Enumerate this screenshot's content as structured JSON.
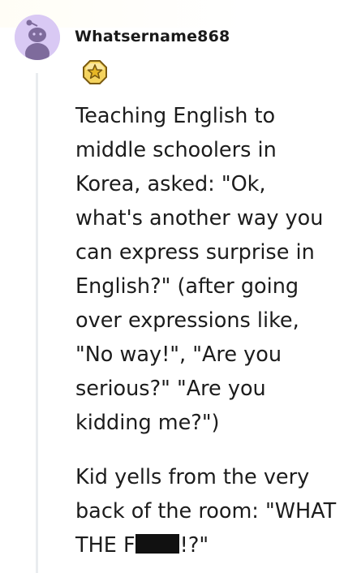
{
  "comment": {
    "author": "Whatsername868",
    "award_icon": "gold-award-star-icon",
    "avatar_icon": "snoo-avatar-icon",
    "paragraph_1": "Teaching English to\nmiddle schoolers in\nKorea, asked: \"Ok,\nwhat's another way you\ncan express surprise in\nEnglish?\" (after going\nover expressions like,\n\"No way!\", \"Are you\nserious?\" \"Are you\nkidding me?\")",
    "paragraph_2_start": "Kid yells from the very\nback of the room: \"WHAT\nTHE F",
    "paragraph_2_end": "!?\""
  },
  "colors": {
    "avatar_bg": "#d9c9f4",
    "avatar_figure": "#7e6b9c",
    "award_gold": "#e6b625",
    "thread_line": "#e9ecef",
    "text": "#1c1c1c"
  }
}
